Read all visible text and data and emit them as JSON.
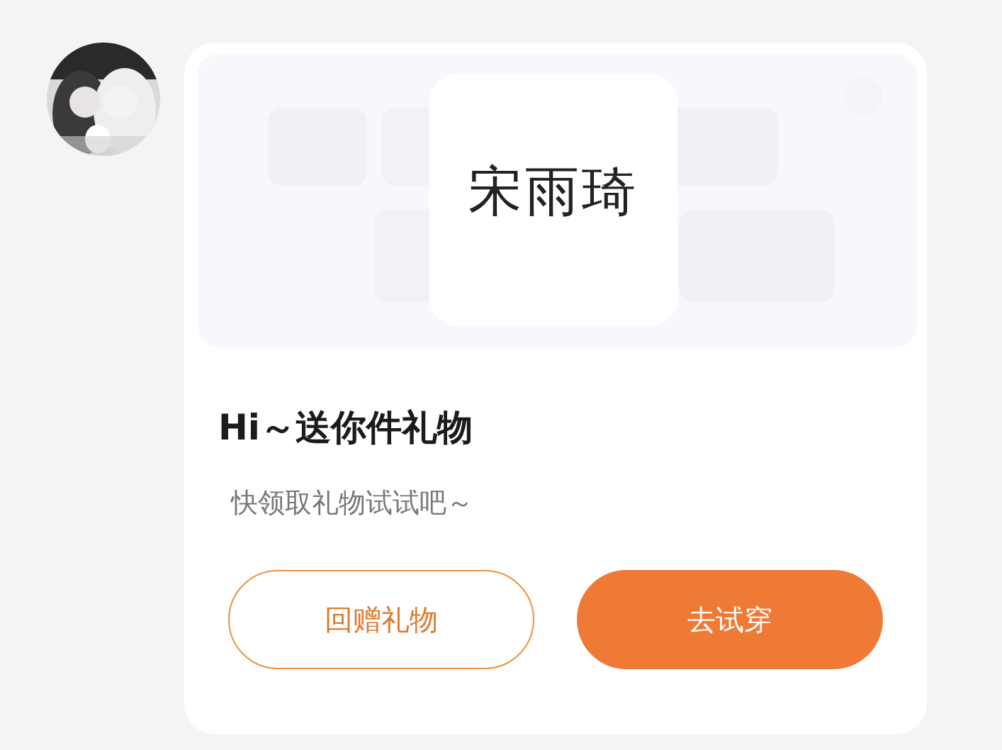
{
  "message": {
    "card": {
      "name_tag": "宋雨琦",
      "title": "Hi～送你件礼物",
      "subtitle": "快领取礼物试试吧～",
      "buttons": [
        {
          "label": "回赠礼物",
          "kind": "outline"
        },
        {
          "label": "去试穿",
          "kind": "filled"
        }
      ]
    }
  }
}
